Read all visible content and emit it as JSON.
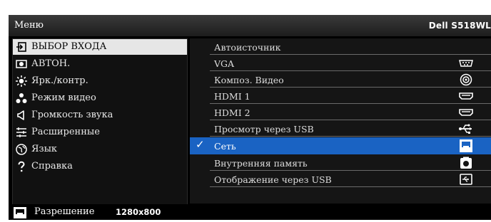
{
  "header": {
    "title": "Меню",
    "model": "Dell S518WL"
  },
  "left_menu": {
    "items": [
      {
        "label": "ВЫБОР ВХОДА",
        "icon": "input-source-icon",
        "selected": true
      },
      {
        "label": "АВТОН.",
        "icon": "standalone-icon"
      },
      {
        "label": "Ярк./контр.",
        "icon": "brightness-icon"
      },
      {
        "label": "Режим видео",
        "icon": "video-mode-icon"
      },
      {
        "label": "Громкость звука",
        "icon": "speaker-icon"
      },
      {
        "label": "Расширенные",
        "icon": "advanced-settings-icon"
      },
      {
        "label": "Язык",
        "icon": "globe-icon"
      },
      {
        "label": "Справка",
        "icon": "help-icon"
      }
    ]
  },
  "right_menu": {
    "items": [
      {
        "label": "Автоисточник"
      },
      {
        "label": "VGA",
        "icon": "vga-port-icon"
      },
      {
        "label": "Композ. Видео",
        "icon": "composite-port-icon"
      },
      {
        "label": "HDMI 1",
        "icon": "hdmi-port-icon"
      },
      {
        "label": "HDMI 2",
        "icon": "hdmi-port-icon"
      },
      {
        "label": "Просмотр через USB",
        "icon": "usb-icon"
      },
      {
        "label": "Сеть",
        "icon": "network-icon",
        "checked": true,
        "highlighted": true
      },
      {
        "label": "Внутренняя память",
        "icon": "internal-memory-icon"
      },
      {
        "label": "Отображение через USB",
        "icon": "usb-display-icon"
      }
    ],
    "highlight_color": "#1a63c3"
  },
  "status_bar": {
    "label": "Разрешение",
    "value": "1280x800",
    "icon": "network-icon"
  }
}
